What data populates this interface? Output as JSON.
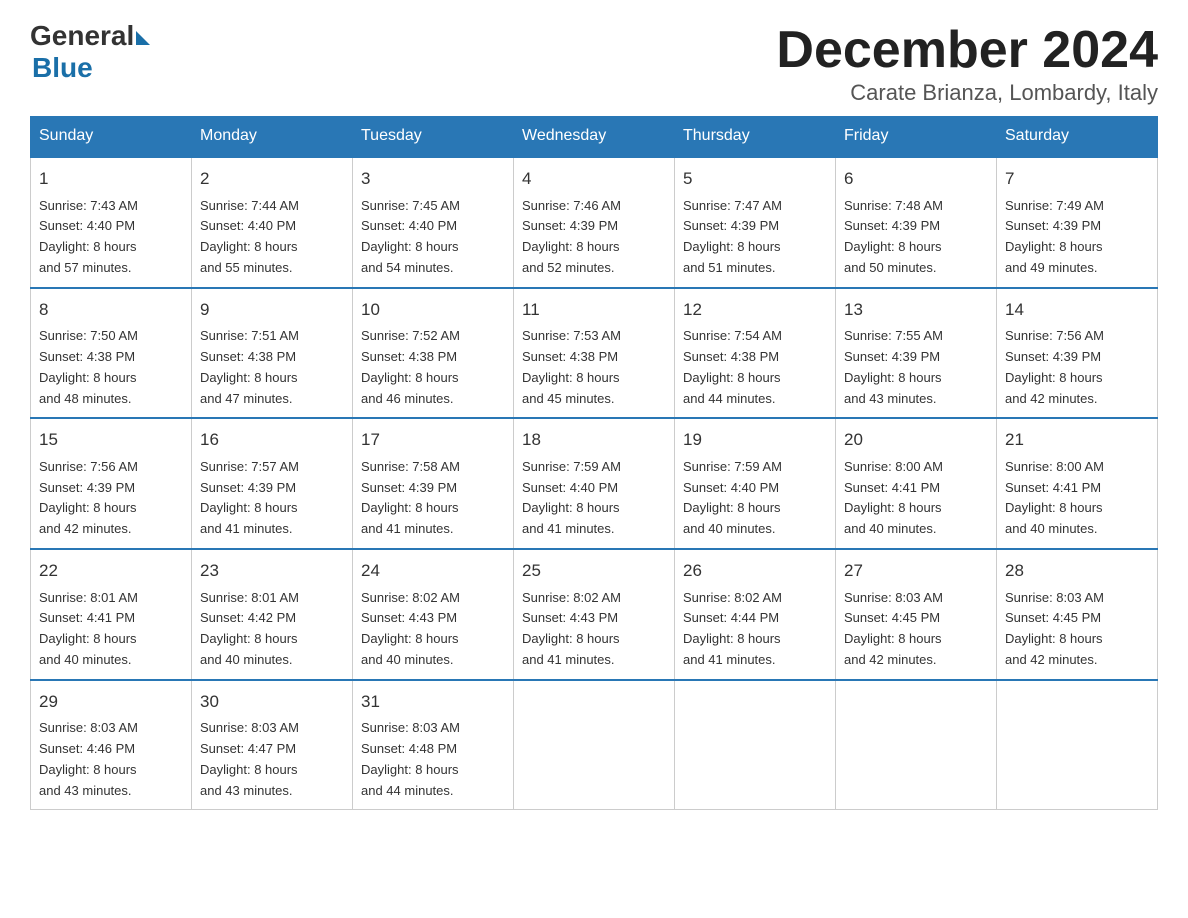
{
  "header": {
    "logo_general": "General",
    "logo_blue": "Blue",
    "month_title": "December 2024",
    "location": "Carate Brianza, Lombardy, Italy"
  },
  "days_of_week": [
    "Sunday",
    "Monday",
    "Tuesday",
    "Wednesday",
    "Thursday",
    "Friday",
    "Saturday"
  ],
  "weeks": [
    [
      {
        "day": "1",
        "sunrise": "7:43 AM",
        "sunset": "4:40 PM",
        "daylight": "8 hours and 57 minutes."
      },
      {
        "day": "2",
        "sunrise": "7:44 AM",
        "sunset": "4:40 PM",
        "daylight": "8 hours and 55 minutes."
      },
      {
        "day": "3",
        "sunrise": "7:45 AM",
        "sunset": "4:40 PM",
        "daylight": "8 hours and 54 minutes."
      },
      {
        "day": "4",
        "sunrise": "7:46 AM",
        "sunset": "4:39 PM",
        "daylight": "8 hours and 52 minutes."
      },
      {
        "day": "5",
        "sunrise": "7:47 AM",
        "sunset": "4:39 PM",
        "daylight": "8 hours and 51 minutes."
      },
      {
        "day": "6",
        "sunrise": "7:48 AM",
        "sunset": "4:39 PM",
        "daylight": "8 hours and 50 minutes."
      },
      {
        "day": "7",
        "sunrise": "7:49 AM",
        "sunset": "4:39 PM",
        "daylight": "8 hours and 49 minutes."
      }
    ],
    [
      {
        "day": "8",
        "sunrise": "7:50 AM",
        "sunset": "4:38 PM",
        "daylight": "8 hours and 48 minutes."
      },
      {
        "day": "9",
        "sunrise": "7:51 AM",
        "sunset": "4:38 PM",
        "daylight": "8 hours and 47 minutes."
      },
      {
        "day": "10",
        "sunrise": "7:52 AM",
        "sunset": "4:38 PM",
        "daylight": "8 hours and 46 minutes."
      },
      {
        "day": "11",
        "sunrise": "7:53 AM",
        "sunset": "4:38 PM",
        "daylight": "8 hours and 45 minutes."
      },
      {
        "day": "12",
        "sunrise": "7:54 AM",
        "sunset": "4:38 PM",
        "daylight": "8 hours and 44 minutes."
      },
      {
        "day": "13",
        "sunrise": "7:55 AM",
        "sunset": "4:39 PM",
        "daylight": "8 hours and 43 minutes."
      },
      {
        "day": "14",
        "sunrise": "7:56 AM",
        "sunset": "4:39 PM",
        "daylight": "8 hours and 42 minutes."
      }
    ],
    [
      {
        "day": "15",
        "sunrise": "7:56 AM",
        "sunset": "4:39 PM",
        "daylight": "8 hours and 42 minutes."
      },
      {
        "day": "16",
        "sunrise": "7:57 AM",
        "sunset": "4:39 PM",
        "daylight": "8 hours and 41 minutes."
      },
      {
        "day": "17",
        "sunrise": "7:58 AM",
        "sunset": "4:39 PM",
        "daylight": "8 hours and 41 minutes."
      },
      {
        "day": "18",
        "sunrise": "7:59 AM",
        "sunset": "4:40 PM",
        "daylight": "8 hours and 41 minutes."
      },
      {
        "day": "19",
        "sunrise": "7:59 AM",
        "sunset": "4:40 PM",
        "daylight": "8 hours and 40 minutes."
      },
      {
        "day": "20",
        "sunrise": "8:00 AM",
        "sunset": "4:41 PM",
        "daylight": "8 hours and 40 minutes."
      },
      {
        "day": "21",
        "sunrise": "8:00 AM",
        "sunset": "4:41 PM",
        "daylight": "8 hours and 40 minutes."
      }
    ],
    [
      {
        "day": "22",
        "sunrise": "8:01 AM",
        "sunset": "4:41 PM",
        "daylight": "8 hours and 40 minutes."
      },
      {
        "day": "23",
        "sunrise": "8:01 AM",
        "sunset": "4:42 PM",
        "daylight": "8 hours and 40 minutes."
      },
      {
        "day": "24",
        "sunrise": "8:02 AM",
        "sunset": "4:43 PM",
        "daylight": "8 hours and 40 minutes."
      },
      {
        "day": "25",
        "sunrise": "8:02 AM",
        "sunset": "4:43 PM",
        "daylight": "8 hours and 41 minutes."
      },
      {
        "day": "26",
        "sunrise": "8:02 AM",
        "sunset": "4:44 PM",
        "daylight": "8 hours and 41 minutes."
      },
      {
        "day": "27",
        "sunrise": "8:03 AM",
        "sunset": "4:45 PM",
        "daylight": "8 hours and 42 minutes."
      },
      {
        "day": "28",
        "sunrise": "8:03 AM",
        "sunset": "4:45 PM",
        "daylight": "8 hours and 42 minutes."
      }
    ],
    [
      {
        "day": "29",
        "sunrise": "8:03 AM",
        "sunset": "4:46 PM",
        "daylight": "8 hours and 43 minutes."
      },
      {
        "day": "30",
        "sunrise": "8:03 AM",
        "sunset": "4:47 PM",
        "daylight": "8 hours and 43 minutes."
      },
      {
        "day": "31",
        "sunrise": "8:03 AM",
        "sunset": "4:48 PM",
        "daylight": "8 hours and 44 minutes."
      },
      null,
      null,
      null,
      null
    ]
  ],
  "labels": {
    "sunrise": "Sunrise:",
    "sunset": "Sunset:",
    "daylight": "Daylight:"
  }
}
